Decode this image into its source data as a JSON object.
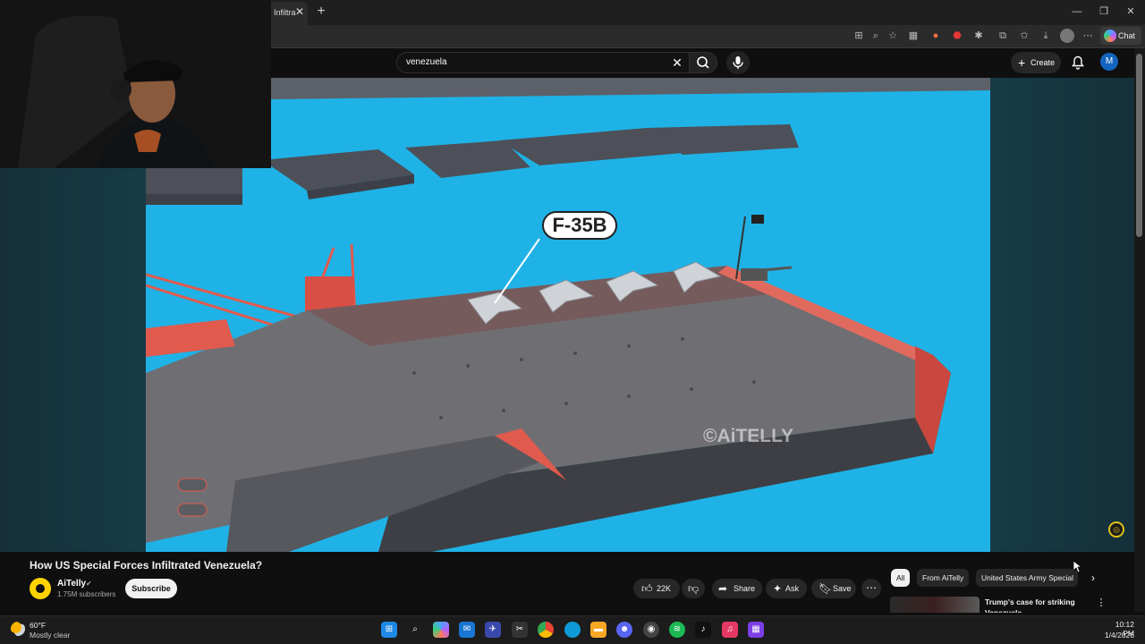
{
  "browser": {
    "tab_title": "Infiltra",
    "tab_close": "✕",
    "new_tab": "+",
    "window_buttons": [
      "—",
      "❐",
      "✕"
    ],
    "chat_label": "Chat"
  },
  "youtube": {
    "search_query": "venezuela",
    "search_clear": "✕",
    "create_label": "Create",
    "avatar_letter": "M"
  },
  "video": {
    "aircraft_label": "F-35B",
    "watermark": "©AiTELLY",
    "title": "How US Special Forces Infiltrated Venezuela?"
  },
  "channel": {
    "name": "AiTelly",
    "verified": "✔",
    "subscribers": "1.75M subscribers",
    "subscribe_label": "Subscribe"
  },
  "actions": {
    "likes": "22K",
    "share_label": "Share",
    "ask_label": "Ask",
    "save_label": "Save",
    "more": "⋯"
  },
  "chips": [
    "All",
    "From AiTelly",
    "United States Army Special"
  ],
  "recommendation": {
    "title": "Trump's case for striking Venezuela",
    "menu": "⋮"
  },
  "taskbar": {
    "temperature": "60°F",
    "weather": "Mostly clear",
    "time": "10:12 PM",
    "date": "1/4/2026"
  },
  "colors": {
    "ocean": "#1fb2e6",
    "deck": "#6f6f73",
    "hull_accent": "#e05a4e",
    "brand_yellow": "#ffd400"
  }
}
